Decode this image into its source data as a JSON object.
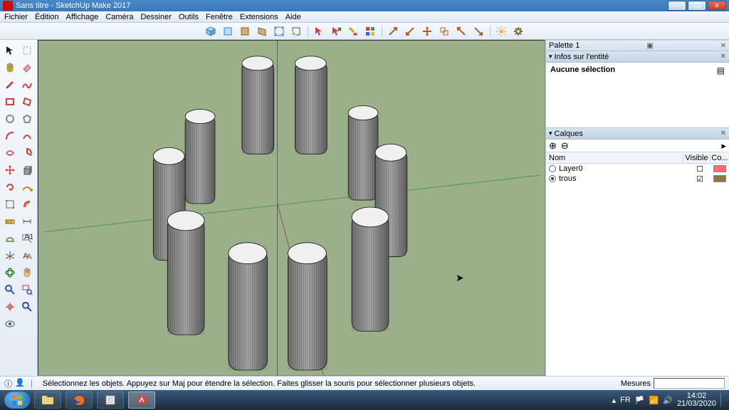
{
  "window": {
    "title": "Sans titre - SketchUp Make 2017"
  },
  "menus": [
    "Fichier",
    "Édition",
    "Affichage",
    "Caméra",
    "Dessiner",
    "Outils",
    "Fenêtre",
    "Extensions",
    "Aide"
  ],
  "panels": {
    "palette": "Palette 1",
    "entity_info": "Infos sur l'entité",
    "entity_text": "Aucune sélection",
    "layers": "Calques",
    "layers_cols": {
      "name": "Nom",
      "visible": "Visible",
      "color": "Co..."
    },
    "layer_items": [
      {
        "name": "Layer0",
        "active": false,
        "visible": false,
        "color": "#ff6a6a"
      },
      {
        "name": "trous",
        "active": true,
        "visible": true,
        "color": "#8a7a3a"
      }
    ]
  },
  "statusbar": {
    "hint": "Sélectionnez les objets. Appuyez sur Maj pour étendre la sélection. Faites glisser la souris pour sélectionner plusieurs objets.",
    "measure_label": "Mesures"
  },
  "taskbar": {
    "lang": "FR",
    "time": "14:02",
    "date": "21/03/2020"
  },
  "top_tools": [
    "cube-iso-icon",
    "cube-top-icon",
    "cube-front-icon",
    "cube-right-icon",
    "zoom-extents-icon",
    "zoom-prev-icon",
    "sep",
    "select-red-icon",
    "select-cross-icon",
    "paint-icon",
    "color-icon",
    "sep",
    "arrow-ne-icon",
    "arrow-sw-icon",
    "arrow-move-icon",
    "arrow-copy-icon",
    "arrow-nw-icon",
    "arrow-se-icon",
    "sep",
    "sun-icon",
    "gear-icon"
  ],
  "left_tools": [
    [
      "select-arrow-icon",
      "rectangle-select-icon"
    ],
    [
      "hand-pan-icon",
      "eraser-pink-icon"
    ],
    [
      "pencil-icon",
      "freehand-icon"
    ],
    [
      "rectangle-icon",
      "rotated-rect-icon"
    ],
    [
      "circle-icon",
      "polygon-icon"
    ],
    [
      "arc-icon",
      "arc-2pt-icon"
    ],
    [
      "arc-3pt-icon",
      "pie-icon"
    ],
    [
      "move-icon",
      "pushpull-icon"
    ],
    [
      "rotate-icon",
      "followme-icon"
    ],
    [
      "scale-icon",
      "offset-icon"
    ],
    [
      "tape-icon",
      "dimension-icon"
    ],
    [
      "protractor-icon",
      "text-label-icon"
    ],
    [
      "axes-icon",
      "3dtext-icon"
    ],
    [
      "orbit-icon",
      "pan-icon"
    ],
    [
      "zoom-icon",
      "zoom-window-icon"
    ],
    [
      "position-camera-icon",
      "zoom-ext-icon"
    ],
    [
      "look-around-icon",
      ""
    ]
  ]
}
